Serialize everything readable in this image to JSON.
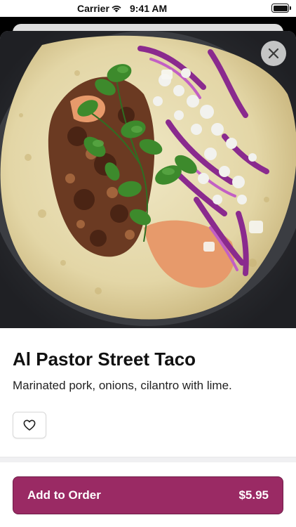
{
  "status_bar": {
    "carrier": "Carrier",
    "time": "9:41 AM"
  },
  "item": {
    "title": "Al Pastor Street Taco",
    "description": "Marinated pork, onions, cilantro with lime.",
    "image_alt": "Photo of an al pastor street taco"
  },
  "actions": {
    "add_label": "Add to Order",
    "price": "$5.95"
  },
  "icons": {
    "close": "close-icon",
    "favorite": "heart-icon",
    "wifi": "wifi-icon",
    "battery": "battery-icon"
  },
  "colors": {
    "accent": "#9a2a64"
  }
}
